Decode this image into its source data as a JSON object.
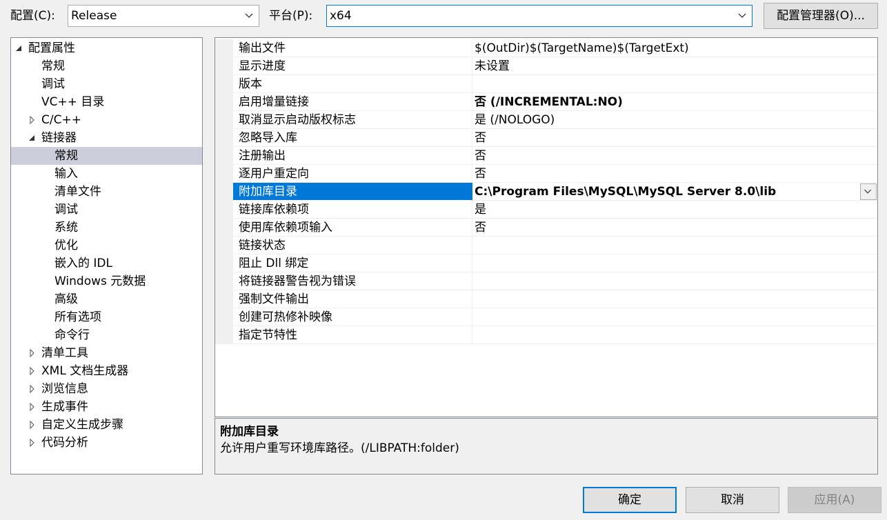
{
  "toolbar": {
    "config_label": "配置(C):",
    "config_value": "Release",
    "platform_label": "平台(P):",
    "platform_value": "x64",
    "config_manager_label": "配置管理器(O)..."
  },
  "tree": {
    "items": [
      {
        "label": "配置属性",
        "expander": "expanded"
      },
      {
        "label": "常规",
        "expander": "none"
      },
      {
        "label": "调试",
        "expander": "none"
      },
      {
        "label": "VC++ 目录",
        "expander": "none"
      },
      {
        "label": "C/C++",
        "expander": "collapsed"
      },
      {
        "label": "链接器",
        "expander": "expanded"
      },
      {
        "label": "常规",
        "expander": "none",
        "selected": true
      },
      {
        "label": "输入",
        "expander": "none"
      },
      {
        "label": "清单文件",
        "expander": "none"
      },
      {
        "label": "调试",
        "expander": "none"
      },
      {
        "label": "系统",
        "expander": "none"
      },
      {
        "label": "优化",
        "expander": "none"
      },
      {
        "label": "嵌入的 IDL",
        "expander": "none"
      },
      {
        "label": "Windows 元数据",
        "expander": "none"
      },
      {
        "label": "高级",
        "expander": "none"
      },
      {
        "label": "所有选项",
        "expander": "none"
      },
      {
        "label": "命令行",
        "expander": "none"
      },
      {
        "label": "清单工具",
        "expander": "collapsed"
      },
      {
        "label": "XML 文档生成器",
        "expander": "collapsed"
      },
      {
        "label": "浏览信息",
        "expander": "collapsed"
      },
      {
        "label": "生成事件",
        "expander": "collapsed"
      },
      {
        "label": "自定义生成步骤",
        "expander": "collapsed"
      },
      {
        "label": "代码分析",
        "expander": "collapsed"
      }
    ]
  },
  "grid": {
    "rows": [
      {
        "name": "输出文件",
        "value": "$(OutDir)$(TargetName)$(TargetExt)"
      },
      {
        "name": "显示进度",
        "value": "未设置"
      },
      {
        "name": "版本",
        "value": ""
      },
      {
        "name": "启用增量链接",
        "value": "否 (/INCREMENTAL:NO)",
        "bold": true
      },
      {
        "name": "取消显示启动版权标志",
        "value": "是 (/NOLOGO)"
      },
      {
        "name": "忽略导入库",
        "value": "否"
      },
      {
        "name": "注册输出",
        "value": "否"
      },
      {
        "name": "逐用户重定向",
        "value": "否"
      },
      {
        "name": "附加库目录",
        "value": "C:\\Program Files\\MySQL\\MySQL Server 8.0\\lib",
        "bold": true,
        "selected": true
      },
      {
        "name": "链接库依赖项",
        "value": "是"
      },
      {
        "name": "使用库依赖项输入",
        "value": "否"
      },
      {
        "name": "链接状态",
        "value": ""
      },
      {
        "name": "阻止 Dll 绑定",
        "value": ""
      },
      {
        "name": "将链接器警告视为错误",
        "value": ""
      },
      {
        "name": "强制文件输出",
        "value": ""
      },
      {
        "name": "创建可热修补映像",
        "value": ""
      },
      {
        "name": "指定节特性",
        "value": ""
      }
    ]
  },
  "description": {
    "title": "附加库目录",
    "text": "允许用户重写环境库路径。(/LIBPATH:folder)"
  },
  "buttons": {
    "ok": "确定",
    "cancel": "取消",
    "apply": "应用(A)"
  },
  "colors": {
    "selection": "#0078d7",
    "tree_selection": "#cccedb",
    "background": "#f0f0f0"
  }
}
